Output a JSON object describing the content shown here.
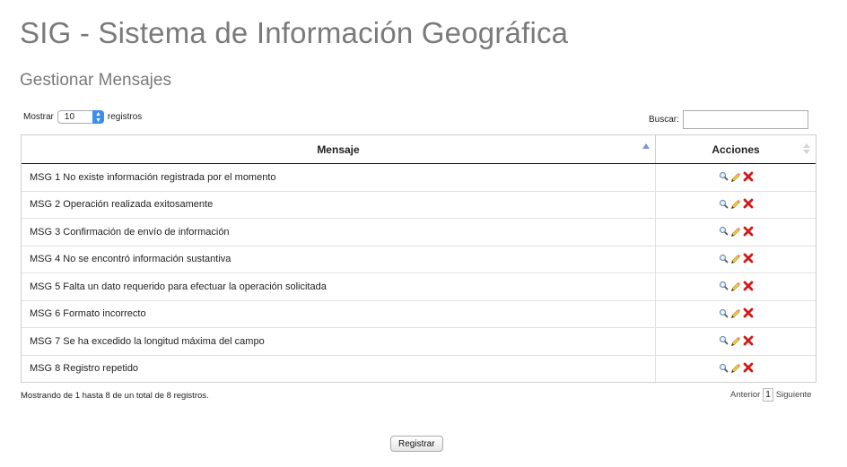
{
  "app": {
    "title": "SIG - Sistema de Información Geográfica"
  },
  "page": {
    "subtitle": "Gestionar Mensajes"
  },
  "controls": {
    "length_prefix": "Mostrar",
    "length_value": "10",
    "length_suffix": "registros",
    "search_label": "Buscar:",
    "search_value": ""
  },
  "table": {
    "headers": {
      "message": "Mensaje",
      "actions": "Acciones"
    },
    "rows": [
      {
        "message": "MSG 1 No existe información registrada por el momento"
      },
      {
        "message": "MSG 2 Operación realizada exitosamente"
      },
      {
        "message": "MSG 3 Confirmación de envío de información"
      },
      {
        "message": "MSG 4 No se encontró información sustantiva"
      },
      {
        "message": "MSG 5 Falta un dato requerido para efectuar la operación solicitada"
      },
      {
        "message": "MSG 6 Formato incorrecto"
      },
      {
        "message": "MSG 7 Se ha excedido la longitud máxima del campo"
      },
      {
        "message": "MSG 8 Registro repetido"
      }
    ],
    "action_icons": [
      "view-icon",
      "edit-icon",
      "delete-icon"
    ]
  },
  "footer": {
    "info": "Mostrando de 1 hasta 8 de un total de 8 registros.",
    "prev_label": "Anterior",
    "current_page": "1",
    "next_label": "Siguiente"
  },
  "buttons": {
    "register": "Registrar"
  },
  "colors": {
    "delete": "#d11a1a",
    "sort_active": "#7f93d0",
    "title_gray": "#7a7a7a"
  }
}
